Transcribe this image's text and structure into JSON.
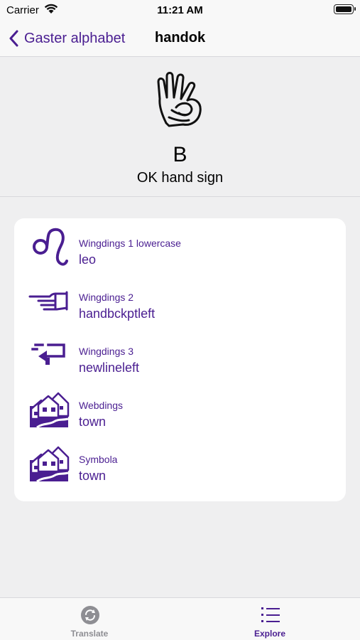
{
  "status_bar": {
    "carrier": "Carrier",
    "time": "11:21 AM"
  },
  "nav": {
    "back_label": "Gaster alphabet",
    "title": "handok"
  },
  "hero": {
    "letter": "B",
    "name": "OK hand sign",
    "glyph_icon": "ok-hand-icon"
  },
  "glyphs": [
    {
      "font": "Wingdings 1 lowercase",
      "name": "leo",
      "icon": "leo-icon"
    },
    {
      "font": "Wingdings 2",
      "name": "handbckptleft",
      "icon": "pointing-hand-left-icon"
    },
    {
      "font": "Wingdings 3",
      "name": "newlineleft",
      "icon": "newline-left-icon"
    },
    {
      "font": "Webdings",
      "name": "town",
      "icon": "town-icon"
    },
    {
      "font": "Symbola",
      "name": "town",
      "icon": "town-icon"
    }
  ],
  "tabs": [
    {
      "label": "Translate",
      "icon": "refresh-icon",
      "active": false
    },
    {
      "label": "Explore",
      "icon": "list-icon",
      "active": true
    }
  ],
  "colors": {
    "accent": "#4a1e91",
    "inactive": "#8e8e93",
    "background": "#efeff0"
  }
}
